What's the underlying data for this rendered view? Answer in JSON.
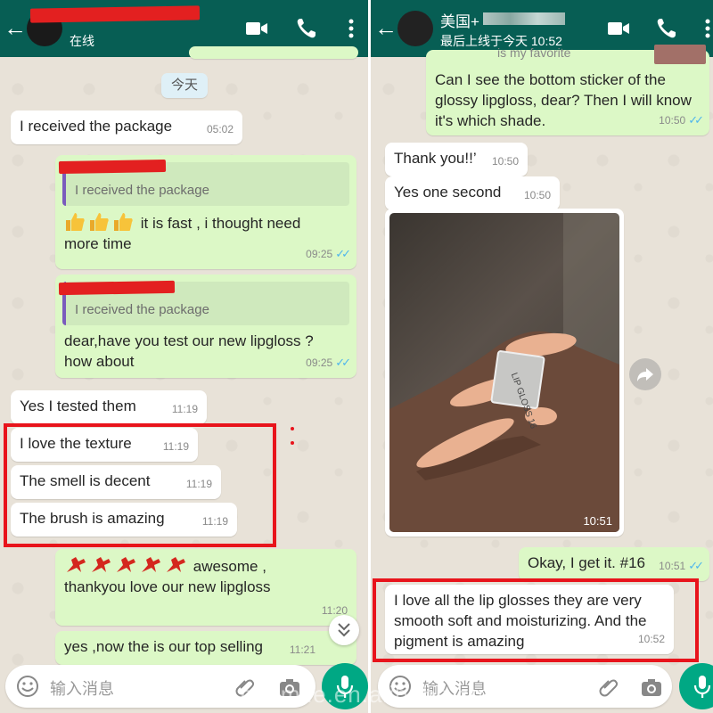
{
  "left": {
    "header": {
      "back_icon": "arrow-left-icon",
      "status": "在线",
      "video_icon": "video-call-icon",
      "phone_icon": "phone-icon",
      "menu_icon": "more-vert-icon"
    },
    "date_pill": "今天",
    "messages": [
      {
        "text": "I received the package",
        "time": "05:02",
        "dir": "in"
      },
      {
        "quote": "I received the package",
        "text": "it is fast , i thought need more time",
        "time": "09:25",
        "dir": "out",
        "emoji": "thumbs-up-icon",
        "emoji_count": 3
      },
      {
        "quote": "I received the package",
        "text": "dear,have you test our new  lipgloss ? how about",
        "time": "09:25",
        "dir": "out"
      },
      {
        "text": "Yes I tested them",
        "time": "11:19",
        "dir": "in"
      },
      {
        "text": "I love the texture",
        "time": "11:19",
        "dir": "in"
      },
      {
        "text": "The smell is decent",
        "time": "11:19",
        "dir": "in"
      },
      {
        "text": "The brush is amazing",
        "time": "11:19",
        "dir": "in"
      },
      {
        "text": "awesome , thankyou love our new lipgloss",
        "time": "11:20",
        "dir": "out",
        "emoji": "dancer-icon",
        "emoji_count": 5
      },
      {
        "text": "yes ,now the is our top selling",
        "time": "11:21",
        "dir": "out"
      }
    ],
    "composer": {
      "placeholder": "输入消息"
    }
  },
  "right": {
    "header": {
      "back_icon": "arrow-left-icon",
      "name_prefix": "美国+",
      "status": "最后上线于今天 10:52",
      "video_icon": "video-call-icon",
      "phone_icon": "phone-icon",
      "menu_icon": "more-vert-icon"
    },
    "messages": [
      {
        "text_partial": "is my favorite",
        "text": "Can I see the bottom sticker of the glossy lipgloss, dear? Then I will know it's which shade.",
        "time": "10:50",
        "dir": "out"
      },
      {
        "text": "Thank you!!’",
        "time": "10:50",
        "dir": "in"
      },
      {
        "text": "Yes one second",
        "time": "10:50",
        "dir": "in"
      },
      {
        "type": "image",
        "time": "10:51",
        "dir": "in",
        "sticker_text": "LIP GLOSS 16"
      },
      {
        "text": "Okay, I get it. #16",
        "time": "10:51",
        "dir": "out"
      },
      {
        "text": "I love all the lip glosses they are very smooth soft and moisturizing. And the pigment is amazing",
        "time": "10:52",
        "dir": "in"
      }
    ],
    "composer": {
      "placeholder": "输入消息"
    }
  },
  "watermark": "ensmile.en.alibaba.com",
  "colors": {
    "header": "#075e54",
    "outgoing": "#dcf8c6",
    "incoming": "#ffffff",
    "highlight": "#e8141c",
    "ticks": "#4fb6ec",
    "mic": "#00a884"
  }
}
